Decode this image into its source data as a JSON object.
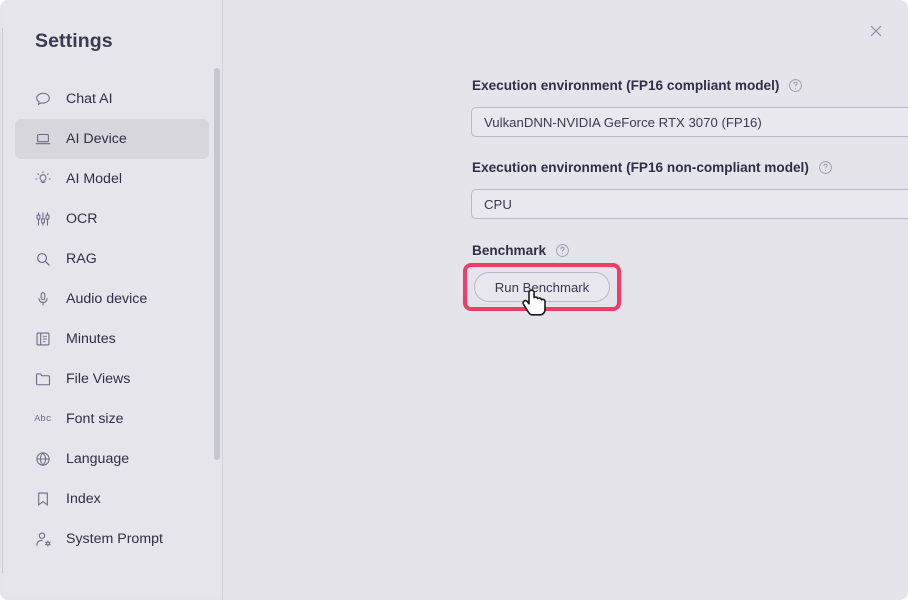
{
  "dialog": {
    "title": "Settings",
    "close_label": "close-icon"
  },
  "sidebar": {
    "items": [
      {
        "label": "Chat AI",
        "icon": "chat-bubble-icon",
        "active": false
      },
      {
        "label": "AI Device",
        "icon": "laptop-icon",
        "active": true
      },
      {
        "label": "AI Model",
        "icon": "lightbulb-icon",
        "active": false
      },
      {
        "label": "OCR",
        "icon": "sliders-icon",
        "active": false
      },
      {
        "label": "RAG",
        "icon": "search-icon",
        "active": false
      },
      {
        "label": "Audio device",
        "icon": "microphone-icon",
        "active": false
      },
      {
        "label": "Minutes",
        "icon": "book-icon",
        "active": false
      },
      {
        "label": "File Views",
        "icon": "folder-icon",
        "active": false
      },
      {
        "label": "Font size",
        "icon": "abc-text-icon",
        "active": false
      },
      {
        "label": "Language",
        "icon": "globe-icon",
        "active": false
      },
      {
        "label": "Index",
        "icon": "bookmark-icon",
        "active": false
      },
      {
        "label": "System Prompt",
        "icon": "user-gear-icon",
        "active": false
      }
    ],
    "font_size_icon_text": "Abc"
  },
  "main": {
    "fp16_compliant": {
      "label": "Execution environment (FP16 compliant model)",
      "value": "VulkanDNN-NVIDIA GeForce RTX 3070 (FP16)"
    },
    "fp16_non_compliant": {
      "label": "Execution environment (FP16 non-compliant model)",
      "value": "CPU"
    },
    "benchmark": {
      "label": "Benchmark",
      "run_button_label": "Run Benchmark"
    }
  },
  "colors": {
    "highlight": "#ee3d68",
    "panel_bg": "#e4e4ea",
    "sidebar_bg": "#e5e5eb",
    "active_item_bg": "#d6d6dc",
    "text": "#2f2f47",
    "icon": "#6b6b86"
  }
}
